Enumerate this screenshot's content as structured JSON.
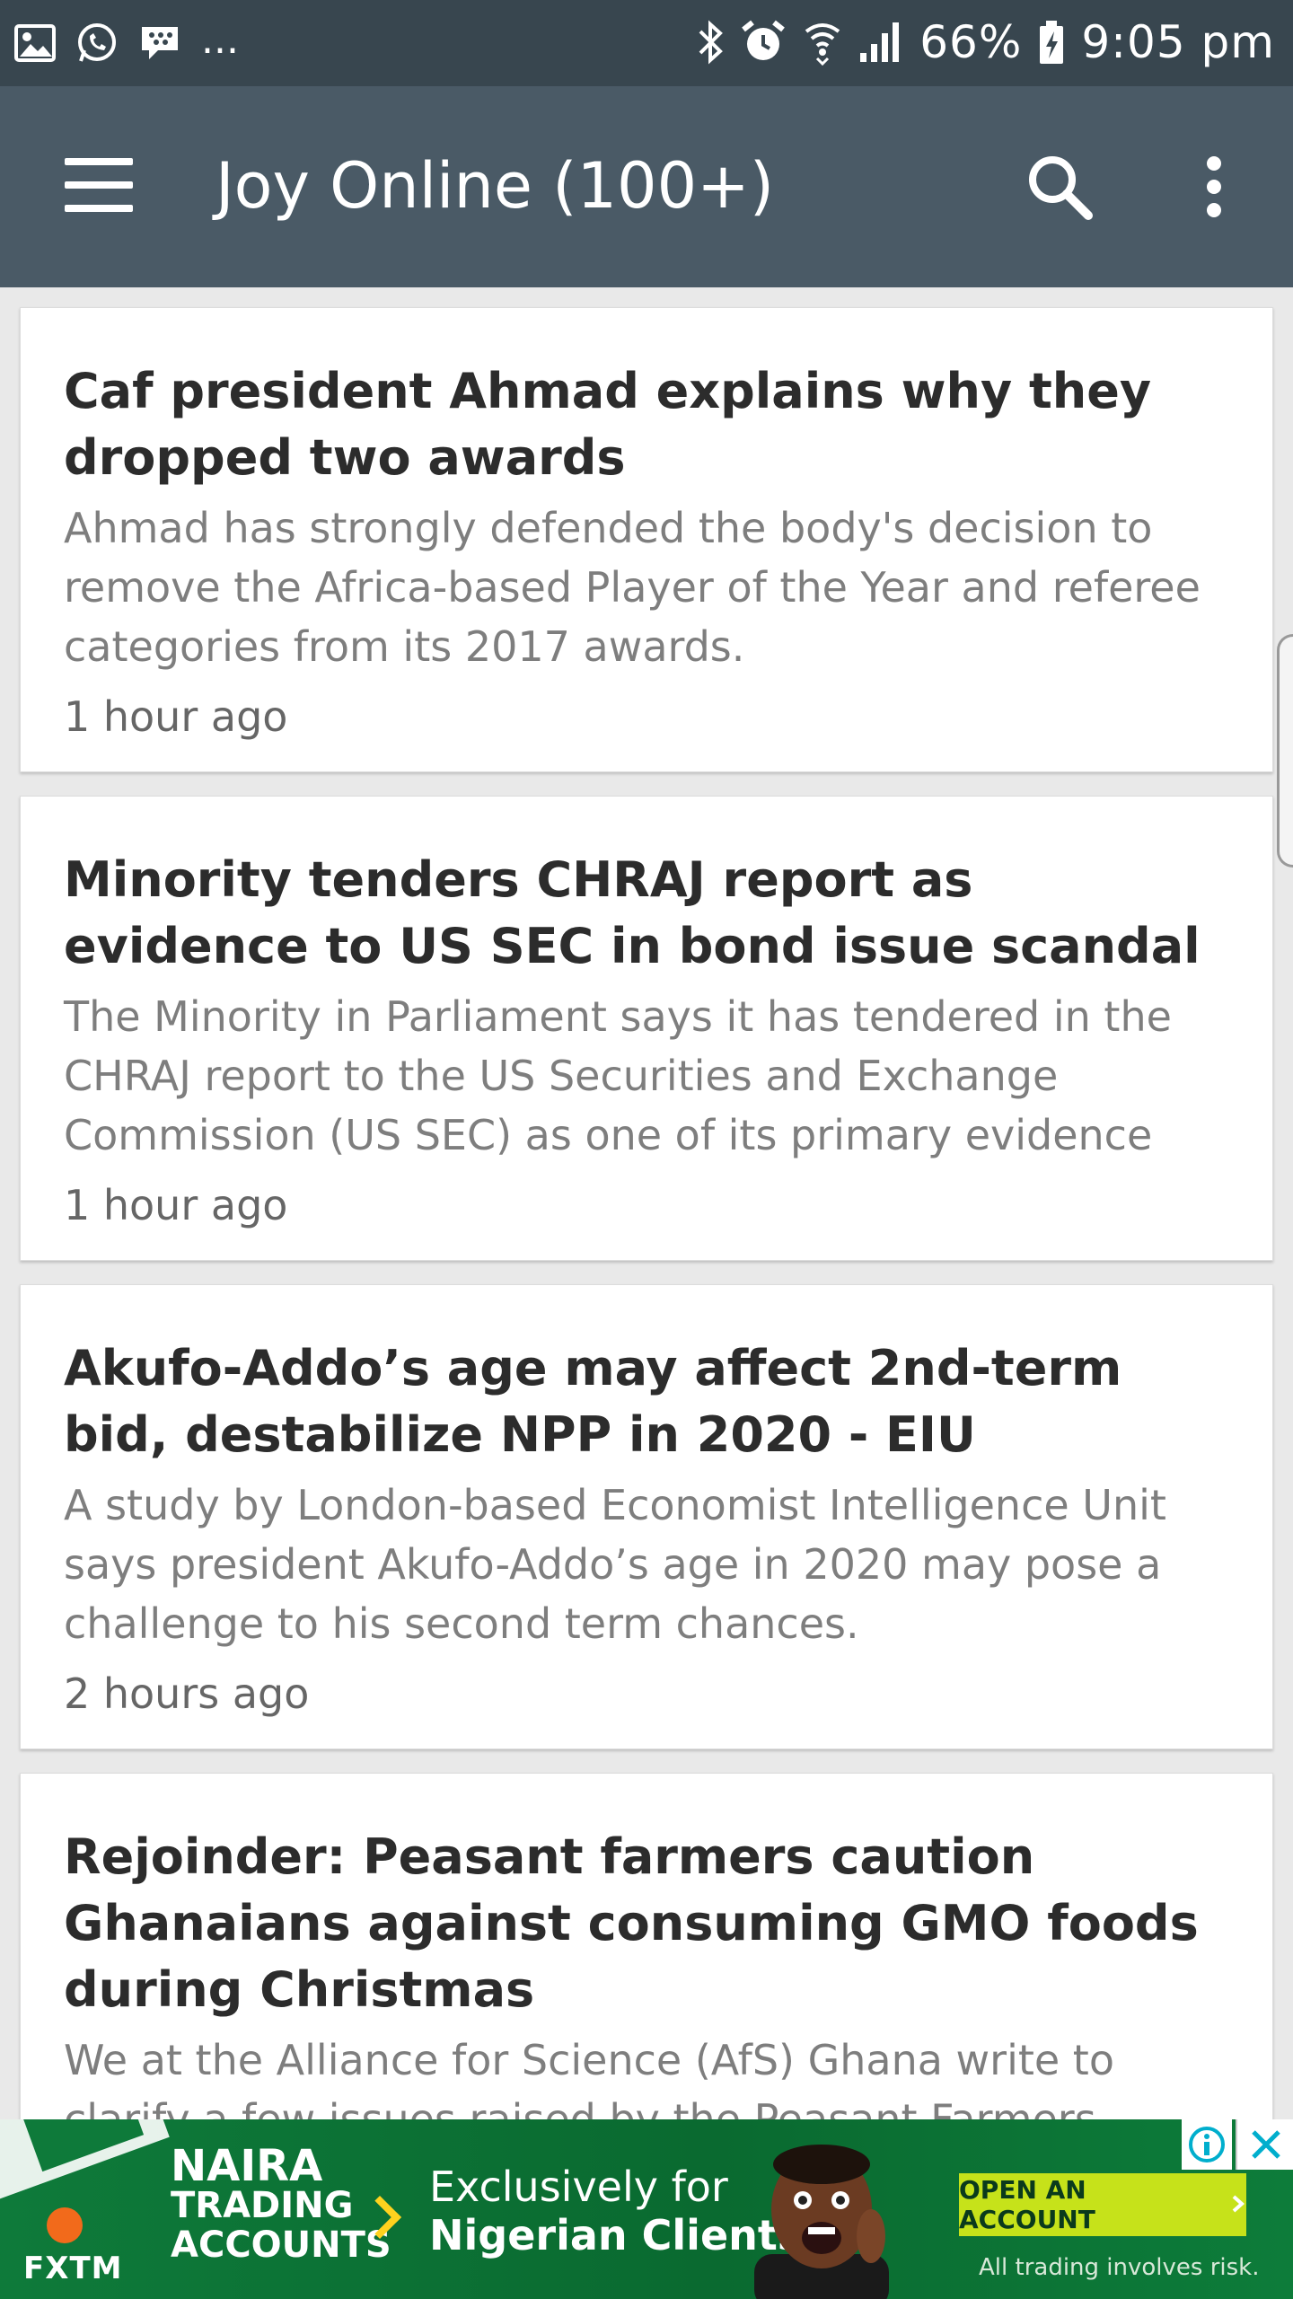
{
  "status_bar": {
    "left_icons": [
      "image-icon",
      "whatsapp-icon",
      "bbm-icon"
    ],
    "overflow": "...",
    "battery": "66%",
    "time": "9:05 pm"
  },
  "app_bar": {
    "title": "Joy Online (100+)"
  },
  "articles": [
    {
      "title": "Caf president Ahmad explains why they dropped two awards",
      "summary": "Ahmad has strongly defended the body's decision to remove the Africa-based Player of the Year and referee categories from its 2017 awards.",
      "time": "1 hour ago"
    },
    {
      "title": "Minority tenders CHRAJ report as evidence to US SEC in bond issue scandal",
      "summary": "The Minority in Parliament says it has tendered in the CHRAJ report to the US Securities and Exchange Commission (US SEC) as one of its primary evidence",
      "time": "1 hour ago"
    },
    {
      "title": "Akufo-Addo’s age may affect 2nd-term bid, destabilize NPP in 2020 - EIU",
      "summary": "A study by London-based Economist Intelligence Unit says president Akufo-Addo’s age in 2020 may pose a challenge to his second term chances.",
      "time": "2 hours ago"
    },
    {
      "title": "Rejoinder: Peasant farmers caution Ghanaians against consuming GMO foods during Christmas",
      "summary": "We at the Alliance for Science (AfS) Ghana write to clarify a few issues raised by the Peasant Farmers Association of Ghana (PFAG) in a recent statement",
      "time": ""
    }
  ],
  "ad": {
    "brand": "FXTM",
    "headline_1": "NAIRA",
    "headline_2": "TRADING",
    "headline_3": "ACCOUNTS",
    "tagline_1": "Exclusively for",
    "tagline_2": "Nigerian Clients",
    "cta": "OPEN AN ACCOUNT",
    "disclaimer": "All trading involves risk."
  },
  "colors": {
    "status_bar": "#38464f",
    "app_bar": "#4a5a66",
    "background": "#e9e9e9",
    "card": "#ffffff",
    "title_text": "#2c2c2c",
    "summary_text": "#7e7e7e",
    "ad_green": "#0e7a3a",
    "ad_cta": "#c6e21a"
  }
}
